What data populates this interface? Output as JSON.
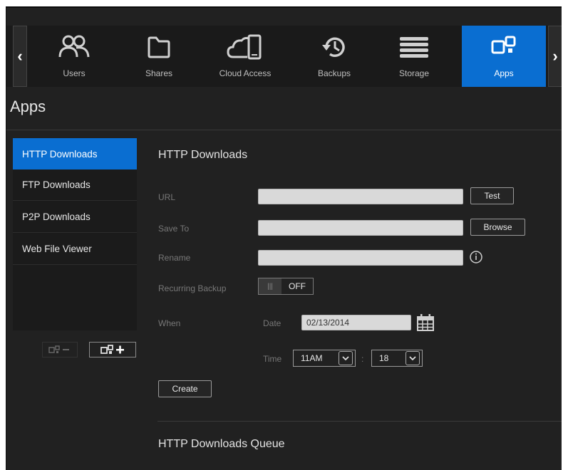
{
  "nav": {
    "items": [
      {
        "label": "Users",
        "icon": "users-icon"
      },
      {
        "label": "Shares",
        "icon": "folder-icon"
      },
      {
        "label": "Cloud Access",
        "icon": "cloud-device-icon"
      },
      {
        "label": "Backups",
        "icon": "history-icon"
      },
      {
        "label": "Storage",
        "icon": "storage-icon"
      },
      {
        "label": "Apps",
        "icon": "apps-icon"
      }
    ],
    "active": "Apps",
    "left_arrow": "‹",
    "right_arrow": "›"
  },
  "page": {
    "title": "Apps"
  },
  "sidebar": {
    "items": [
      {
        "label": "HTTP Downloads"
      },
      {
        "label": "FTP Downloads"
      },
      {
        "label": "P2P Downloads"
      },
      {
        "label": "Web File Viewer"
      }
    ],
    "active": "HTTP Downloads"
  },
  "main": {
    "section_title": "HTTP Downloads",
    "url_label": "URL",
    "url_value": "",
    "test_label": "Test",
    "save_to_label": "Save To",
    "save_to_value": "",
    "browse_label": "Browse",
    "rename_label": "Rename",
    "rename_value": "",
    "recurring_label": "Recurring Backup",
    "recurring_knob": "|||",
    "recurring_state": "OFF",
    "when_label": "When",
    "date_label": "Date",
    "date_value": "02/13/2014",
    "time_label": "Time",
    "hour_value": "11AM",
    "time_separator": ":",
    "minute_value": "18",
    "create_label": "Create",
    "queue_title": "HTTP Downloads Queue"
  },
  "colors": {
    "accent": "#0a6ed1",
    "background": "#212121",
    "input_bg": "#d9d9d9"
  }
}
